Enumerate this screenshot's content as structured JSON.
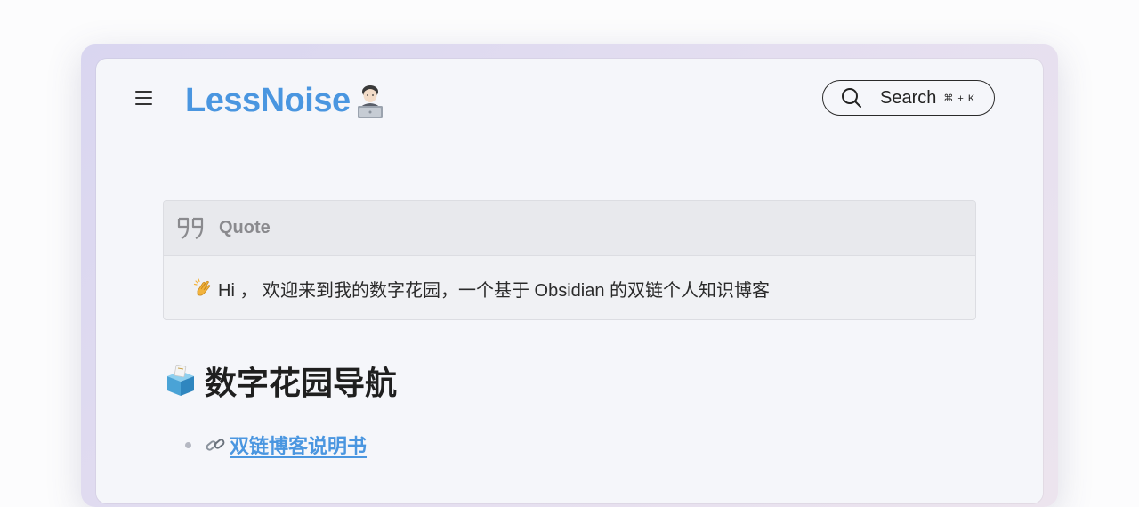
{
  "header": {
    "logo_text": "LessNoise",
    "logo_emoji": "technologist-emoji",
    "search": {
      "label": "Search",
      "shortcut": "⌘ + K"
    }
  },
  "callout": {
    "title": "Quote",
    "emoji": "clapping-hands-emoji",
    "text": "Hi ，  欢迎来到我的数字花园，一个基于 Obsidian 的双链个人知识博客"
  },
  "section": {
    "emoji": "ballot-box-emoji",
    "heading": "数字花园导航",
    "items": [
      {
        "emoji": "link-emoji",
        "label": "双链博客说明书"
      }
    ]
  },
  "colors": {
    "accent": "#4a96e0",
    "page_bg": "#f5f6fa",
    "text": "#1f1f1f"
  }
}
